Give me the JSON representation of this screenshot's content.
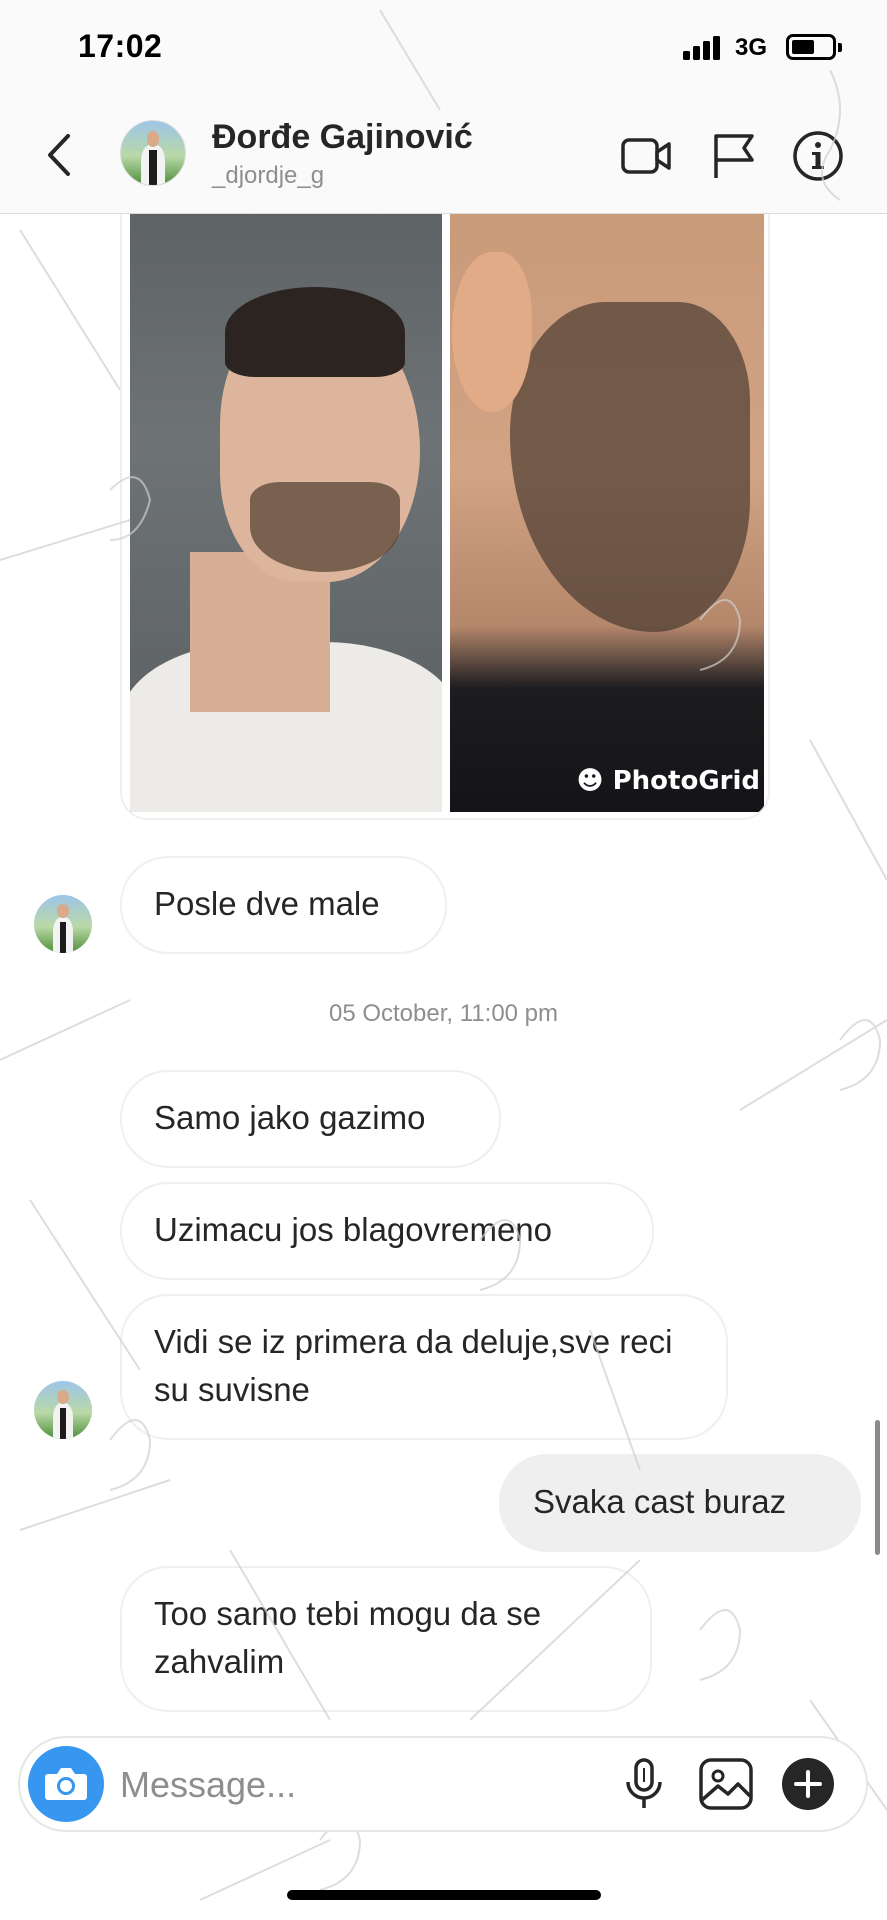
{
  "status_bar": {
    "time": "17:02",
    "network": "3G"
  },
  "header": {
    "name": "Đorđe Gajinović",
    "username": "_djordje_g",
    "icons": [
      "back-icon",
      "video-call-icon",
      "flag-icon",
      "info-icon"
    ]
  },
  "photo_message": {
    "watermark": "PhotoGrid"
  },
  "messages": [
    {
      "text": "Posle dve male",
      "from": "them"
    },
    {
      "text": "Samo jako gazimo",
      "from": "them"
    },
    {
      "text": "Uzimacu jos blagovremeno",
      "from": "them"
    },
    {
      "text": "Vidi se iz primera da deluje,sve reci su suvisne",
      "from": "them"
    },
    {
      "text": "Svaka cast buraz",
      "from": "me"
    },
    {
      "text": "Too samo tebi mogu da se zahvalim",
      "from": "them"
    }
  ],
  "timestamp": "05 October, 11:00 pm",
  "composer": {
    "placeholder": "Message...",
    "icons": [
      "camera-icon",
      "microphone-icon",
      "gallery-icon",
      "plus-icon"
    ]
  },
  "colors": {
    "accent": "#3797f0",
    "bubble_mine": "#efefef",
    "bubble_border": "#efefef",
    "muted_text": "#8e8e8e"
  }
}
